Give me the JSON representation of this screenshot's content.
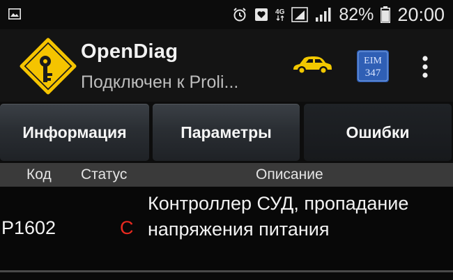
{
  "status_bar": {
    "network_label": "4G",
    "battery_percent": "82%",
    "time": "20:00",
    "icons": [
      "gallery-icon",
      "alarm-icon",
      "heart-notification-icon",
      "network-4g-icon",
      "signal-icon",
      "battery-icon"
    ]
  },
  "app_bar": {
    "title": "OpenDiag",
    "subtitle": "Подключен к Proli...",
    "ecu_badge": "EIM 347",
    "icons": [
      "app-logo-icon",
      "car-icon",
      "ecu-icon",
      "overflow-menu-icon"
    ],
    "colors": {
      "logo_yellow": "#f5c400",
      "car_yellow": "#f2c800",
      "ecu_blue": "#2f5fb5"
    }
  },
  "tabs": [
    {
      "label": "Информация",
      "active": false
    },
    {
      "label": "Параметры",
      "active": false
    },
    {
      "label": "Ошибки",
      "active": true
    }
  ],
  "table": {
    "columns": {
      "code": "Код",
      "status": "Статус",
      "description": "Описание"
    },
    "rows": [
      {
        "code": "P1602",
        "status": "C",
        "description": "Контроллер СУД, пропадание напряжения питания"
      }
    ],
    "colors": {
      "status_error": "#e8291f",
      "header_bg": "#3a3a3a"
    }
  }
}
